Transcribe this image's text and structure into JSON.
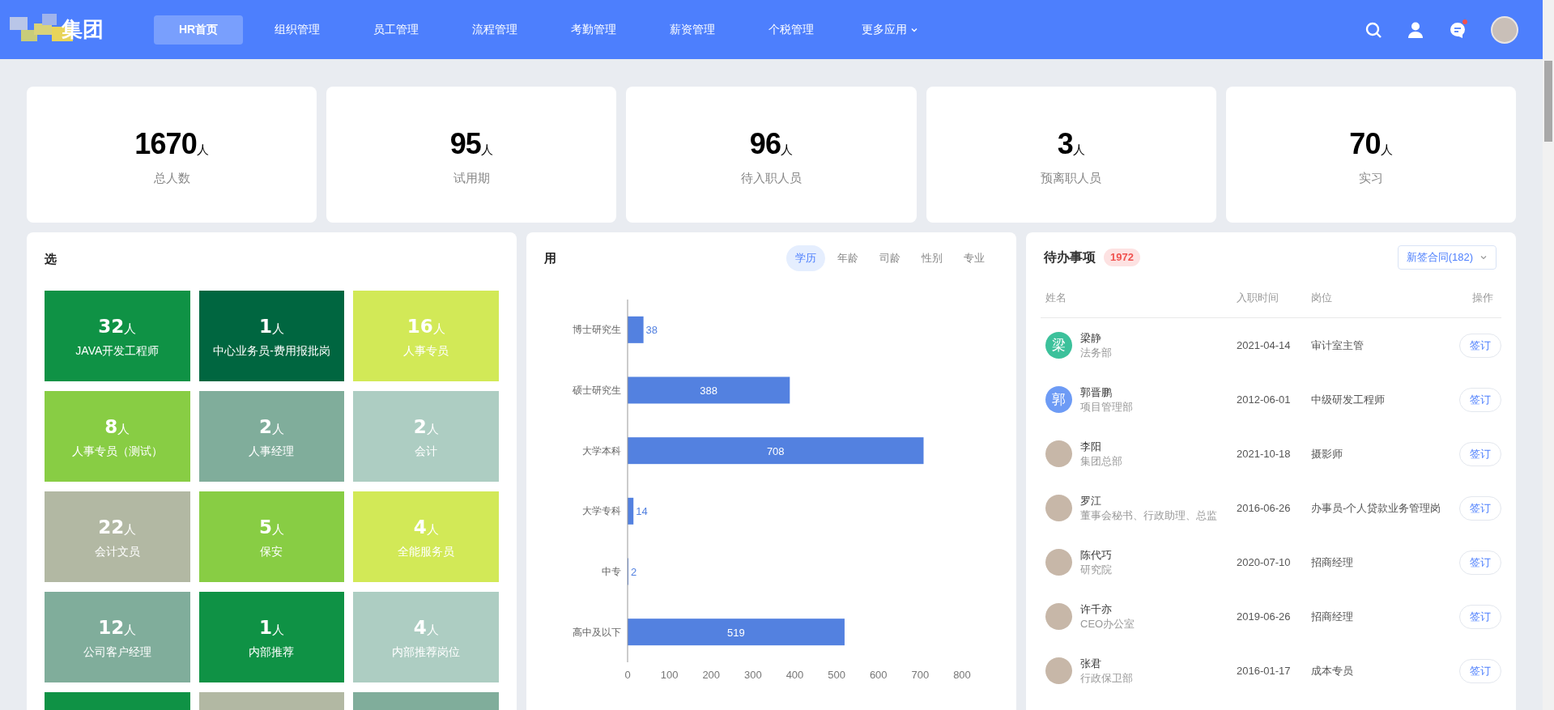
{
  "header": {
    "logo_text": "集团",
    "nav": [
      {
        "label": "HR首页",
        "selected": true
      },
      {
        "label": "组织管理",
        "selected": false
      },
      {
        "label": "员工管理",
        "selected": false
      },
      {
        "label": "流程管理",
        "selected": false
      },
      {
        "label": "考勤管理",
        "selected": false
      },
      {
        "label": "薪资管理",
        "selected": false
      },
      {
        "label": "个税管理",
        "selected": false
      },
      {
        "label": "更多应用",
        "selected": false,
        "dropdown": true
      }
    ],
    "has_notification": true
  },
  "stats": [
    {
      "value": "1670",
      "unit": "人",
      "label": "总人数"
    },
    {
      "value": "95",
      "unit": "人",
      "label": "试用期"
    },
    {
      "value": "96",
      "unit": "人",
      "label": "待入职人员"
    },
    {
      "value": "3",
      "unit": "人",
      "label": "预离职人员"
    },
    {
      "value": "70",
      "unit": "人",
      "label": "实习"
    }
  ],
  "positions_panel": {
    "title": "选",
    "tiles": [
      {
        "count": "32",
        "unit": "人",
        "label": "JAVA开发工程师",
        "color": "#0f9245"
      },
      {
        "count": "1",
        "unit": "人",
        "label": "中心业务员-费用报批岗",
        "color": "#006640"
      },
      {
        "count": "16",
        "unit": "人",
        "label": "人事专员",
        "color": "#d2e957"
      },
      {
        "count": "8",
        "unit": "人",
        "label": "人事专员（测试）",
        "color": "#88cd44"
      },
      {
        "count": "2",
        "unit": "人",
        "label": "人事经理",
        "color": "#80ad9b"
      },
      {
        "count": "2",
        "unit": "人",
        "label": "会计",
        "color": "#adcdc2"
      },
      {
        "count": "22",
        "unit": "人",
        "label": "会计文员",
        "color": "#b2b8a3"
      },
      {
        "count": "5",
        "unit": "人",
        "label": "保安",
        "color": "#88cd44"
      },
      {
        "count": "4",
        "unit": "人",
        "label": "全能服务员",
        "color": "#d2e957"
      },
      {
        "count": "12",
        "unit": "人",
        "label": "公司客户经理",
        "color": "#80ad9b"
      },
      {
        "count": "1",
        "unit": "人",
        "label": "内部推荐",
        "color": "#0f9245"
      },
      {
        "count": "4",
        "unit": "人",
        "label": "内部推荐岗位",
        "color": "#adcdc2"
      },
      {
        "color": "#0f9245"
      },
      {
        "color": "#b2b8a3"
      },
      {
        "color": "#80ad9b"
      }
    ]
  },
  "chart_panel": {
    "title": "用",
    "tabs": [
      {
        "label": "学历",
        "selected": true
      },
      {
        "label": "年龄",
        "selected": false
      },
      {
        "label": "司龄",
        "selected": false
      },
      {
        "label": "性别",
        "selected": false
      },
      {
        "label": "专业",
        "selected": false
      }
    ],
    "chart_data": {
      "type": "bar",
      "orientation": "horizontal",
      "categories": [
        "博士研究生",
        "硕士研究生",
        "大学本科",
        "大学专科",
        "中专",
        "高中及以下"
      ],
      "series": [
        {
          "color": "#5381e0",
          "values": [
            38,
            388,
            708,
            14,
            2,
            519
          ]
        }
      ],
      "xlim": [
        0,
        800
      ],
      "xticks": [
        0,
        100,
        200,
        300,
        400,
        500,
        600,
        700,
        800
      ],
      "data_labels": true
    }
  },
  "todo_panel": {
    "title": "待办事项",
    "badge": "1972",
    "filter": "新签合同(182)",
    "columns": [
      "姓名",
      "入职时间",
      "岗位",
      "操作"
    ],
    "rows": [
      {
        "kind": "letter",
        "avatar_text": "梁",
        "color": "#3cc19b",
        "name": "梁静",
        "dept": "法务部",
        "date": "2021-04-14",
        "position": "审计室主管",
        "action": "签订"
      },
      {
        "kind": "letter",
        "avatar_text": "郭",
        "color": "#6d9bf5",
        "name": "郭晋鹏",
        "dept": "项目管理部",
        "date": "2012-06-01",
        "position": "中级研发工程师",
        "action": "签订"
      },
      {
        "kind": "photo",
        "name": "李阳",
        "dept": "集团总部",
        "date": "2021-10-18",
        "position": "摄影师",
        "action": "签订"
      },
      {
        "kind": "photo",
        "name": "罗江",
        "dept": "董事会秘书、行政助理、总监",
        "date": "2016-06-26",
        "position": "办事员-个人贷款业务管理岗",
        "action": "签订"
      },
      {
        "kind": "photo",
        "name": "陈代巧",
        "dept": "研究院",
        "date": "2020-07-10",
        "position": "招商经理",
        "action": "签订"
      },
      {
        "kind": "photo",
        "name": "许千亦",
        "dept": "CEO办公室",
        "date": "2019-06-26",
        "position": "招商经理",
        "action": "签订"
      },
      {
        "kind": "photo",
        "name": "张君",
        "dept": "行政保卫部",
        "date": "2016-01-17",
        "position": "成本专员",
        "action": "签订"
      }
    ]
  }
}
